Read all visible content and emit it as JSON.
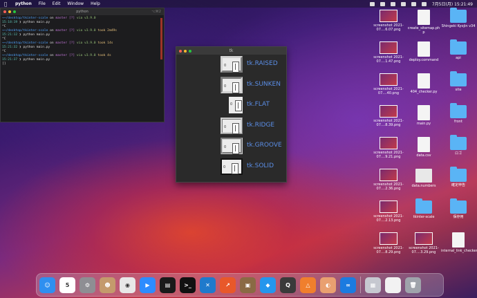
{
  "menubar": {
    "app": "python",
    "items": [
      "File",
      "Edit",
      "Window",
      "Help"
    ],
    "clock": "7月5日(月) 15:21:49"
  },
  "terminal": {
    "title": "python",
    "shortcut": "⌥⌘2",
    "lines": [
      {
        "path": "~/desktop/tkinter-scale",
        "branch": "master [?]",
        "ver": "v3.9.0",
        "took": ""
      },
      {
        "cmd": "python main.py",
        "time": "15:18:19"
      },
      {
        "prompt": "^C"
      },
      {
        "path": "~/desktop/tkinter-scale",
        "branch": "master [?]",
        "ver": "v3.9.0",
        "took": "took 2m49s"
      },
      {
        "cmd": "python main.py",
        "time": "15:21:12"
      },
      {
        "prompt": "^C"
      },
      {
        "path": "~/desktop/tkinter-scale",
        "branch": "master [?]",
        "ver": "v3.9.0",
        "took": "took 14s"
      },
      {
        "cmd": "python main.py",
        "time": "15:21:32"
      },
      {
        "prompt": "^C"
      },
      {
        "path": "~/desktop/tkinter-scale",
        "branch": "master [?]",
        "ver": "v3.9.0",
        "took": "took 4s"
      },
      {
        "cmd": "python main.py",
        "time": "15:21:37"
      },
      {
        "prompt": "[]"
      }
    ]
  },
  "tk": {
    "title": "tk",
    "rows": [
      {
        "value": "0",
        "label": "tk.RAISED"
      },
      {
        "value": "0",
        "label": "tk.SUNKEN"
      },
      {
        "value": "0",
        "label": "tk.FLAT"
      },
      {
        "value": "0",
        "label": "tk.RIDGE"
      },
      {
        "value": "0",
        "label": "tk.GROOVE"
      },
      {
        "value": "0",
        "label": "tk.SOLID"
      }
    ]
  },
  "desktop": {
    "icons": [
      {
        "label": "screenshot 2021-07....6.07.png",
        "kind": "shot"
      },
      {
        "label": "create_sitemap.ph p",
        "kind": "doc"
      },
      {
        "label": "Shingeki Kyojin v34",
        "kind": "folder"
      },
      {
        "label": "screenshot 2021-07....1.47.png",
        "kind": "shot"
      },
      {
        "label": "deploy.command",
        "kind": "doc"
      },
      {
        "label": "api",
        "kind": "folder"
      },
      {
        "label": "screenshot 2021-07....40.png",
        "kind": "shot"
      },
      {
        "label": "404_checker.py",
        "kind": "doc"
      },
      {
        "label": "site",
        "kind": "folder"
      },
      {
        "label": "screenshot 2021-07....8.39.png",
        "kind": "shot"
      },
      {
        "label": "main.py",
        "kind": "doc"
      },
      {
        "label": "front",
        "kind": "folder"
      },
      {
        "label": "screenshot 2021-07....9.21.png",
        "kind": "shot"
      },
      {
        "label": "data.csv",
        "kind": "doc"
      },
      {
        "label": "ロゴ",
        "kind": "folder"
      },
      {
        "label": "screenshot 2021-07....2.36.png",
        "kind": "shot"
      },
      {
        "label": "data.numbers",
        "kind": "sheet"
      },
      {
        "label": "確定申告",
        "kind": "folder"
      },
      {
        "label": "screenshot 2021-07....2.13.png",
        "kind": "shot"
      },
      {
        "label": "tkinter-scale",
        "kind": "folder"
      },
      {
        "label": "保存用",
        "kind": "folder"
      },
      {
        "label": "screenshot 2021-07....8.29.png",
        "kind": "shot"
      },
      {
        "label": "screenshot 2021-07....3.29.png",
        "kind": "shot"
      },
      {
        "label": "internal_link_checker.py",
        "kind": "doc"
      }
    ]
  },
  "dock": {
    "apps": [
      {
        "name": "finder-icon",
        "color": "#2f8ff0",
        "glyph": "☺"
      },
      {
        "name": "calendar-icon",
        "color": "#ffffff",
        "glyph": "5"
      },
      {
        "name": "system-preferences-icon",
        "color": "#8e8e93",
        "glyph": "⚙"
      },
      {
        "name": "contacts-icon",
        "color": "#c49a6c",
        "glyph": "☻"
      },
      {
        "name": "chrome-icon",
        "color": "#e8e8e8",
        "glyph": "◉"
      },
      {
        "name": "zoom-icon",
        "color": "#2d8cff",
        "glyph": "▶"
      },
      {
        "name": "activity-monitor-icon",
        "color": "#1a1a1a",
        "glyph": "▤"
      },
      {
        "name": "terminal-icon",
        "color": "#111111",
        "glyph": ">_"
      },
      {
        "name": "vscode-icon",
        "color": "#1f7acc",
        "glyph": "✕"
      },
      {
        "name": "chart-app-icon",
        "color": "#e8582a",
        "glyph": "↗"
      },
      {
        "name": "archive-icon",
        "color": "#8a6a44",
        "glyph": "▣"
      },
      {
        "name": "docker-icon",
        "color": "#2496ed",
        "glyph": "◆"
      },
      {
        "name": "quicktime-icon",
        "color": "#3a3a3a",
        "glyph": "Q"
      },
      {
        "name": "sourcetree-icon",
        "color": "#f07f2d",
        "glyph": "△"
      },
      {
        "name": "preview-icon",
        "color": "#e9a070",
        "glyph": "◐"
      },
      {
        "name": "loop-app-icon",
        "color": "#1b7be0",
        "glyph": "∞"
      }
    ],
    "right": [
      {
        "name": "screenshot-folder-icon",
        "color": "#c6c8d0",
        "glyph": "▦"
      },
      {
        "name": "document-icon",
        "color": "#f2f2f2",
        "glyph": " "
      },
      {
        "name": "trash-icon",
        "color": "#9fa3ab",
        "glyph": "🗑"
      }
    ]
  }
}
